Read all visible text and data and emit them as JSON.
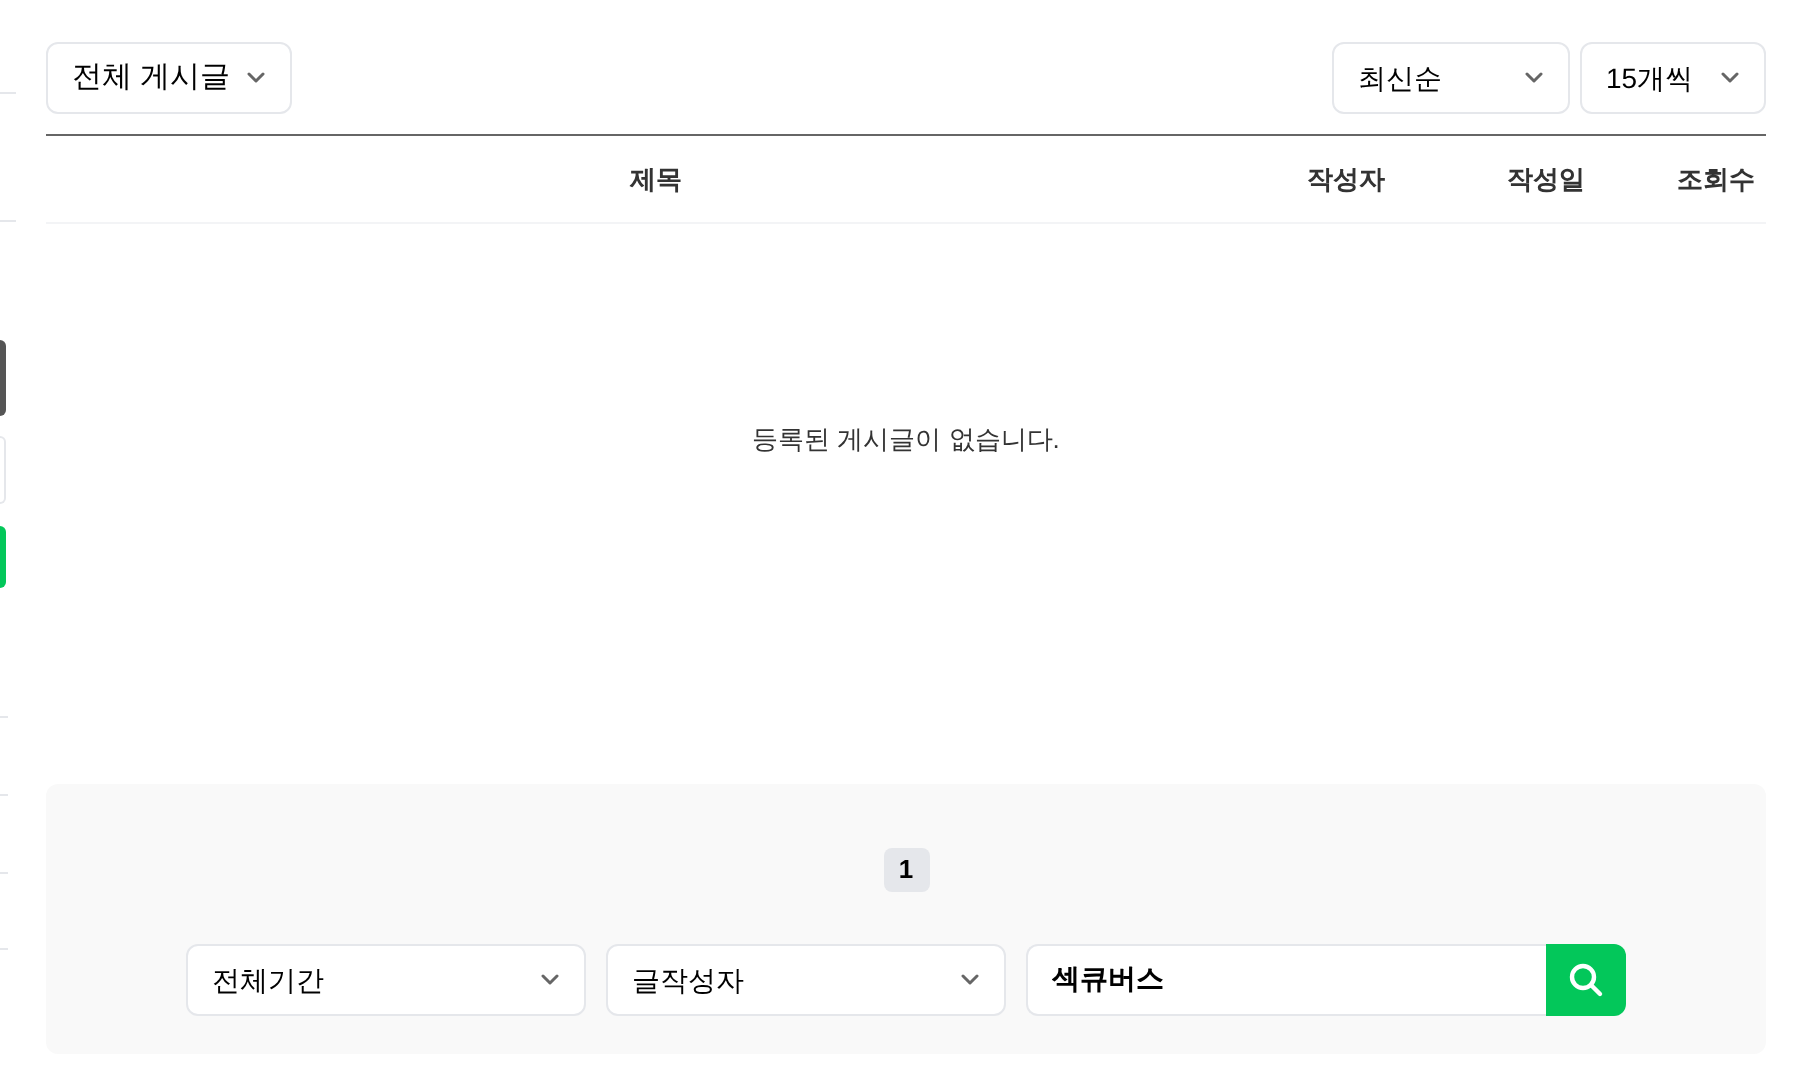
{
  "category_select": {
    "value": "전체 게시글"
  },
  "sort_select": {
    "value": "최신순"
  },
  "page_size_select": {
    "value": "15개씩"
  },
  "table": {
    "columns": [
      "제목",
      "작성자",
      "작성일",
      "조회수"
    ],
    "empty_message": "등록된 게시글이 없습니다."
  },
  "pagination": [
    {
      "label": "1",
      "selected": true
    }
  ],
  "search": {
    "period": "전체기간",
    "field": "글작성자",
    "query": "섹큐버스"
  }
}
